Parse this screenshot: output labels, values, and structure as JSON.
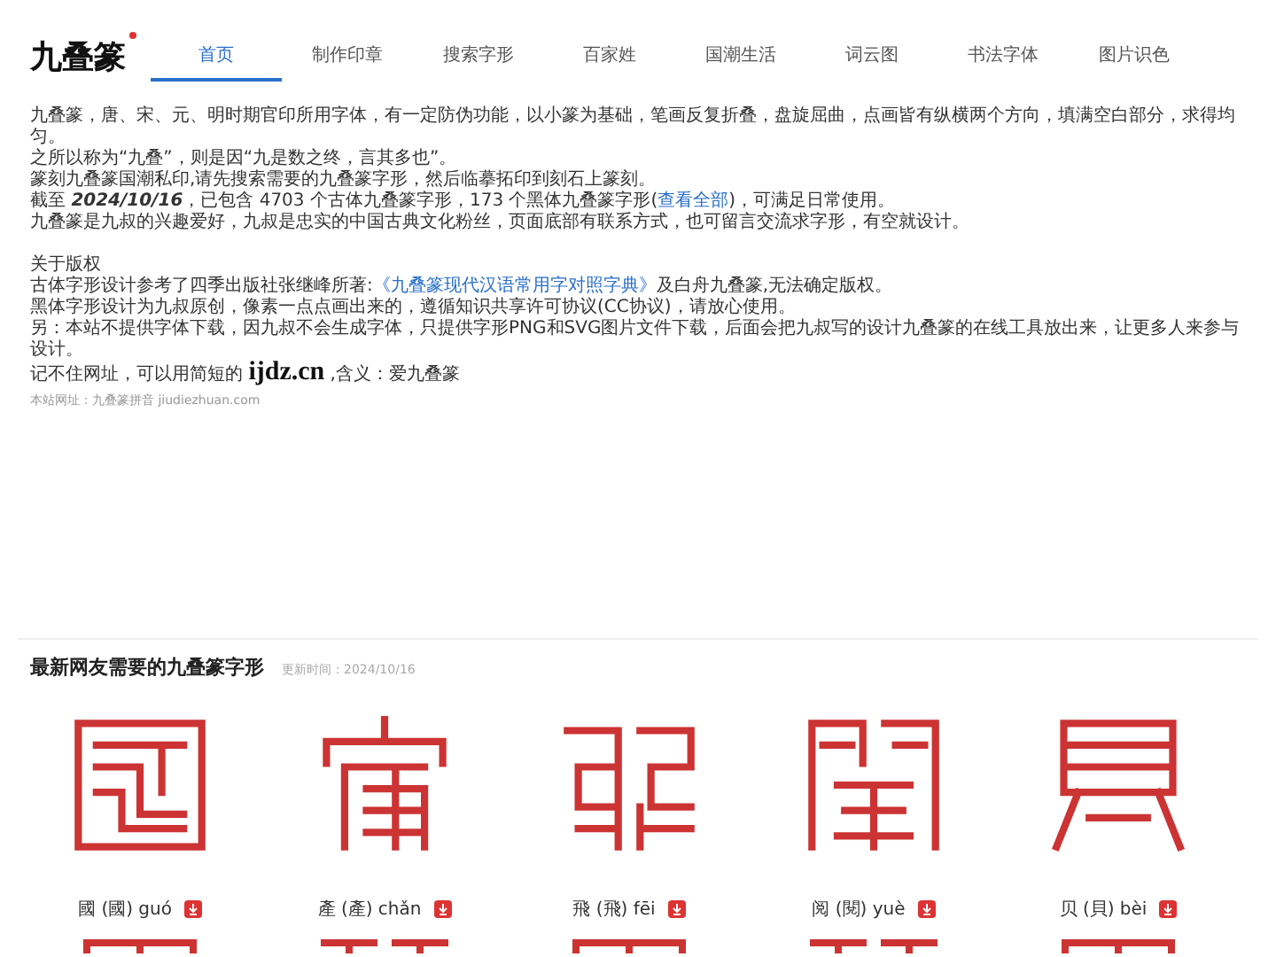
{
  "logo": {
    "text": "九叠篆"
  },
  "nav": [
    {
      "label": "首页",
      "selected": true
    },
    {
      "label": "制作印章",
      "selected": false
    },
    {
      "label": "搜索字形",
      "selected": false
    },
    {
      "label": "百家姓",
      "selected": false
    },
    {
      "label": "国潮生活",
      "selected": false
    },
    {
      "label": "词云图",
      "selected": false
    },
    {
      "label": "书法字体",
      "selected": false
    },
    {
      "label": "图片识色",
      "selected": false
    }
  ],
  "intro": [
    {
      "kind": "text",
      "text": "九叠篆，唐、宋、元、明时期官印所用字体，有一定防伪功能，以小篆为基础，笔画反复折叠，盘旋屈曲，点画皆有纵横两个方向，填满空白部分，求得均匀。"
    },
    {
      "kind": "text",
      "text": "之所以称为“九叠”，则是因“九是数之终，言其多也”。"
    },
    {
      "kind": "text",
      "text": "篆刻九叠篆国潮私印,请先搜索需要的九叠篆字形，然后临摹拓印到刻石上篆刻。"
    },
    {
      "kind": "link",
      "before": "截至 **2024/10/16**，已包含 4703 个古体九叠篆字形，173 个黑体九叠篆字形(",
      "link": "查看全部",
      "after": ")，可满足日常使用。"
    },
    {
      "kind": "text",
      "text": "九叠篆是九叔的兴趣爱好，九叔是忠实的中国古典文化粉丝，页面底部有联系方式，也可留言交流求字形，有空就设计。"
    }
  ],
  "copyright": {
    "title": "关于版权",
    "lines": [
      {
        "kind": "link",
        "before": "古体字形设计参考了四季出版社张继峰所著:",
        "link": "《九叠篆现代汉语常用字对照字典》",
        "after": "及白舟九叠篆,无法确定版权。"
      },
      {
        "kind": "text",
        "text": "黑体字形设计为九叔原创，像素一点点画出来的，遵循知识共享许可协议(CC协议)，请放心使用。"
      },
      {
        "kind": "text",
        "text": "另：本站不提供字体下载，因九叔不会生成字体，只提供字形PNG和SVG图片文件下载，后面会把九叔写的设计九叠篆的在线工具放出来，让更多人来参与设计。"
      },
      {
        "kind": "domain",
        "before": "记不住网址，可以用简短的",
        "link": "ijdz.cn",
        "after": ",含义：爱九叠篆"
      }
    ],
    "site_note": "本站网址：九叠篆拼音 jiudiezhuan.com"
  },
  "latest": {
    "title": "最新网友需要的九叠篆字形",
    "updated": "更新时间：2024/10/16",
    "cards": [
      {
        "label": "國 (國) guó"
      },
      {
        "label": "產 (產) chǎn"
      },
      {
        "label": "飛 (飛) fēi"
      },
      {
        "label": "阅 (閱) yuè"
      },
      {
        "label": "贝 (貝) bèi"
      }
    ]
  }
}
